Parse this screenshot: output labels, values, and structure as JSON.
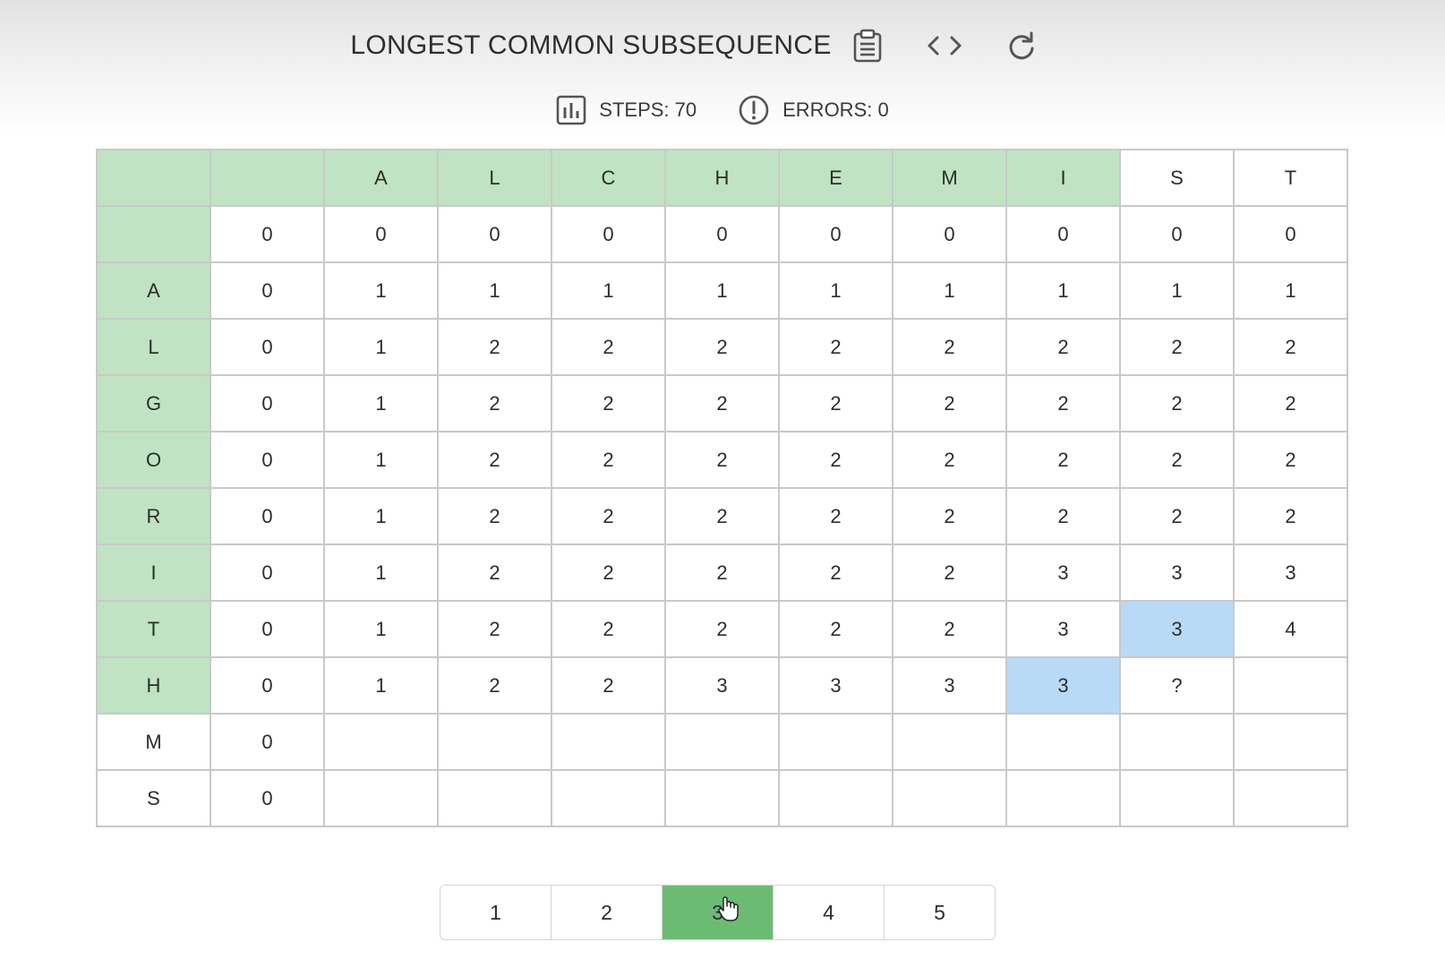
{
  "header": {
    "title": "LONGEST COMMON SUBSEQUENCE",
    "icons": [
      "clipboard-icon",
      "code-icon",
      "refresh-icon"
    ]
  },
  "stats": {
    "steps": "STEPS: 70",
    "errors": "ERRORS: 0",
    "icons": [
      "bar-chart-icon",
      "alert-icon"
    ]
  },
  "table": {
    "column_letters": [
      "A",
      "L",
      "C",
      "H",
      "E",
      "M",
      "I",
      "S",
      "T"
    ],
    "row_letters": [
      "A",
      "L",
      "G",
      "O",
      "R",
      "I",
      "T",
      "H",
      "M",
      "S"
    ],
    "rows": [
      [
        "",
        "",
        "A",
        "L",
        "C",
        "H",
        "E",
        "M",
        "I",
        "S",
        "T"
      ],
      [
        "",
        "0",
        "0",
        "0",
        "0",
        "0",
        "0",
        "0",
        "0",
        "0",
        "0"
      ],
      [
        "A",
        "0",
        "1",
        "1",
        "1",
        "1",
        "1",
        "1",
        "1",
        "1",
        "1"
      ],
      [
        "L",
        "0",
        "1",
        "2",
        "2",
        "2",
        "2",
        "2",
        "2",
        "2",
        "2"
      ],
      [
        "G",
        "0",
        "1",
        "2",
        "2",
        "2",
        "2",
        "2",
        "2",
        "2",
        "2"
      ],
      [
        "O",
        "0",
        "1",
        "2",
        "2",
        "2",
        "2",
        "2",
        "2",
        "2",
        "2"
      ],
      [
        "R",
        "0",
        "1",
        "2",
        "2",
        "2",
        "2",
        "2",
        "2",
        "2",
        "2"
      ],
      [
        "I",
        "0",
        "1",
        "2",
        "2",
        "2",
        "2",
        "2",
        "3",
        "3",
        "3"
      ],
      [
        "T",
        "0",
        "1",
        "2",
        "2",
        "2",
        "2",
        "2",
        "3",
        "3",
        "4"
      ],
      [
        "H",
        "0",
        "1",
        "2",
        "2",
        "3",
        "3",
        "3",
        "3",
        "?",
        ""
      ],
      [
        "M",
        "0",
        "",
        "",
        "",
        "",
        "",
        "",
        "",
        "",
        ""
      ],
      [
        "S",
        "0",
        "",
        "",
        "",
        "",
        "",
        "",
        "",
        "",
        ""
      ]
    ],
    "colors": {
      "processed": "#c0e3c3",
      "compare": "#b9daf6",
      "border": "#c9c9c9"
    },
    "current_cell": "?"
  },
  "pagination": {
    "pages": [
      "1",
      "2",
      "3",
      "4",
      "5"
    ],
    "active_page": "3",
    "active_color": "#6bbb73"
  }
}
